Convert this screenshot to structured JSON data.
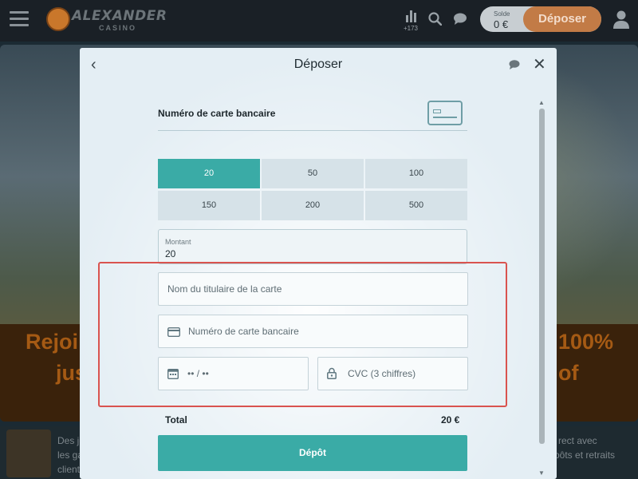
{
  "header": {
    "logo_text": "ALEXANDER",
    "logo_sub": "CASINO",
    "stats_count": "+173",
    "balance_label": "Solde",
    "balance_value": "0 €",
    "deposit_label": "Déposer"
  },
  "hero": {
    "headline_left_1": "Rejoi",
    "headline_left_2": "jus",
    "headline_right_1": "100%",
    "headline_right_2": "of",
    "promo_left_1": "Des je",
    "promo_left_2": "les ga",
    "promo_left_3": "client",
    "promo_right_1": "rect avec",
    "promo_right_2": "pôts et retraits"
  },
  "modal": {
    "title": "Déposer",
    "back_icon": "chevron-left-icon",
    "close_icon": "close-icon",
    "method_label": "Numéro de carte bancaire",
    "amounts": [
      "20",
      "50",
      "100",
      "150",
      "200",
      "500"
    ],
    "selected_amount": "20",
    "amount_field_label": "Montant",
    "amount_field_value": "20",
    "cardholder_placeholder": "Nom du titulaire de la carte",
    "card_number_placeholder": "Numéro de carte bancaire",
    "expiry_placeholder": "•• / ••",
    "cvc_placeholder": "CVC (3 chiffres)",
    "total_label": "Total",
    "total_value": "20 €",
    "submit_label": "Dépôt"
  },
  "colors": {
    "accent": "#3aaba6",
    "deposit_button": "#c27b46",
    "highlight": "#d9534f"
  }
}
